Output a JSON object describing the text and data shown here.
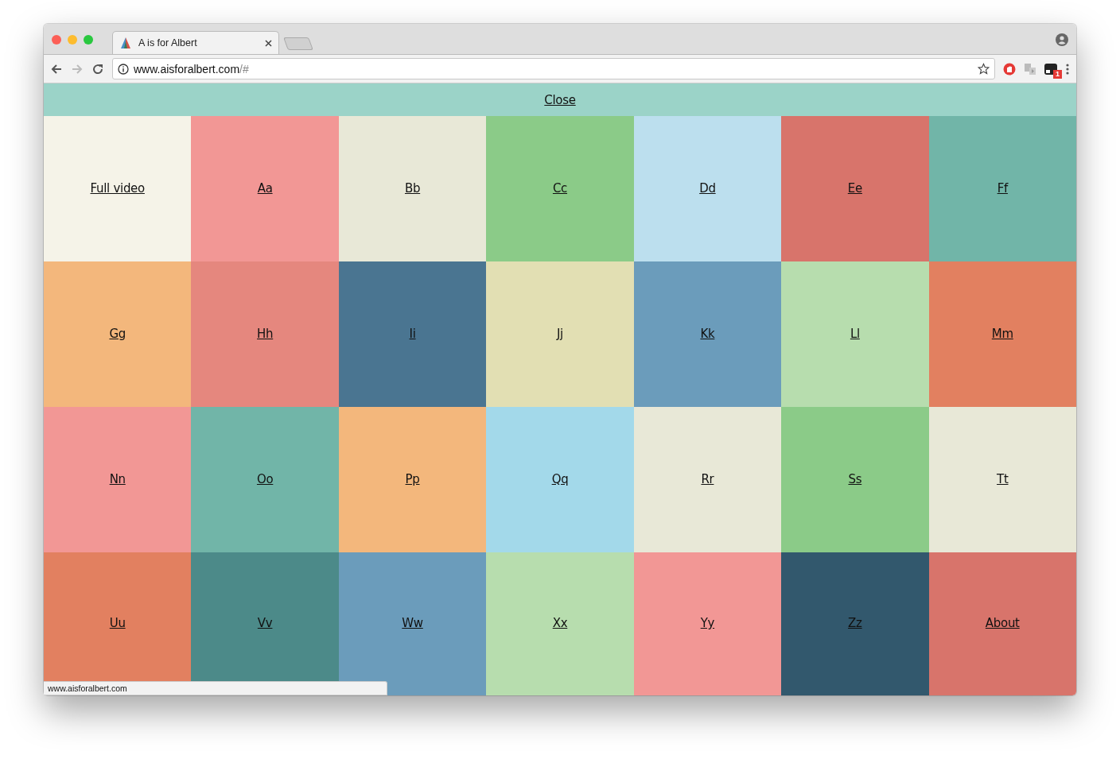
{
  "window": {
    "tab_title": "A is for Albert",
    "url_host": "www.aisforalbert.com",
    "url_path": "/#",
    "extension_badge": "1"
  },
  "close_bar": {
    "label": "Close"
  },
  "tiles": [
    {
      "label": "Full video",
      "color": "#f5f3e8"
    },
    {
      "label": "Aa",
      "color": "#f29795"
    },
    {
      "label": "Bb",
      "color": "#e8e8d7"
    },
    {
      "label": "Cc",
      "color": "#8bcb88"
    },
    {
      "label": "Dd",
      "color": "#bcdfee"
    },
    {
      "label": "Ee",
      "color": "#d8746b"
    },
    {
      "label": "Ff",
      "color": "#71b5a8"
    },
    {
      "label": "Gg",
      "color": "#f3b77c"
    },
    {
      "label": "Hh",
      "color": "#e5877e"
    },
    {
      "label": "Ii",
      "color": "#4a7591"
    },
    {
      "label": "Jj",
      "color": "#e2dfb3"
    },
    {
      "label": "Kk",
      "color": "#6b9cbb"
    },
    {
      "label": "Ll",
      "color": "#b7ddae"
    },
    {
      "label": "Mm",
      "color": "#e28060"
    },
    {
      "label": "Nn",
      "color": "#f29795"
    },
    {
      "label": "Oo",
      "color": "#71b5a8"
    },
    {
      "label": "Pp",
      "color": "#f3b77c"
    },
    {
      "label": "Qq",
      "color": "#a3d9ea"
    },
    {
      "label": "Rr",
      "color": "#e8e8d7"
    },
    {
      "label": "Ss",
      "color": "#8bcb88"
    },
    {
      "label": "Tt",
      "color": "#e8e8d7"
    },
    {
      "label": "Uu",
      "color": "#e28060"
    },
    {
      "label": "Vv",
      "color": "#4c8a89"
    },
    {
      "label": "Ww",
      "color": "#6b9cbb"
    },
    {
      "label": "Xx",
      "color": "#b7ddae"
    },
    {
      "label": "Yy",
      "color": "#f29795"
    },
    {
      "label": "Zz",
      "color": "#32586d"
    },
    {
      "label": "About",
      "color": "#d8746b"
    }
  ],
  "status_bar": {
    "text": "www.aisforalbert.com"
  }
}
